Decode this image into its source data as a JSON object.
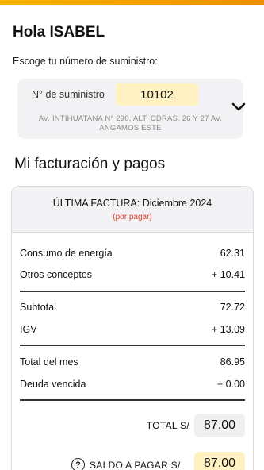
{
  "greeting": "Hola ISABEL",
  "supply": {
    "prompt": "Escoge tu número de suministro:",
    "label": "N° de suministro",
    "number": "10102",
    "address": "AV. INTIHUATANA N° 290, ALT. CDRAS. 26 Y 27 AV. ANGAMOS ESTE"
  },
  "section_title": "Mi facturación y pagos",
  "bill": {
    "title": "ÚLTIMA FACTURA: Diciembre 2024",
    "status": "(por pagar)",
    "rows": [
      {
        "label": "Consumo de energía",
        "value": "62.31"
      },
      {
        "label": "Otros conceptos",
        "value": "+ 10.41"
      },
      {
        "label": "Subtotal",
        "value": "72.72"
      },
      {
        "label": "IGV",
        "value": "+ 13.09"
      },
      {
        "label": "Total del mes",
        "value": "86.95"
      },
      {
        "label": "Deuda vencida",
        "value": "+ 0.00"
      }
    ],
    "total_label": "TOTAL S/",
    "total_value": "87.00",
    "balance_label": "SALDO A PAGAR S/",
    "balance_value": "87.00",
    "help_glyph": "?"
  },
  "colors": {
    "accent_bar": "#f7b500",
    "highlight": "#fff1c2",
    "status_red": "#e2402b"
  },
  "icons": [
    "chevron-down-icon",
    "help-icon"
  ]
}
